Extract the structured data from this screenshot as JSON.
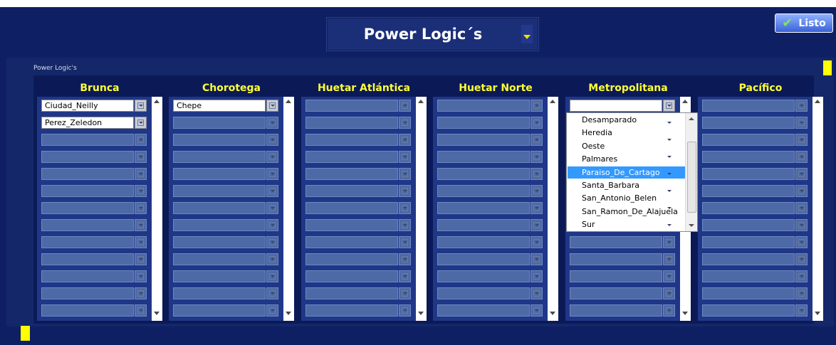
{
  "header": {
    "title": "Power Logic´s",
    "done_label": "Listo"
  },
  "panel": {
    "label": "Power Logic's"
  },
  "columns": [
    {
      "name": "Brunca",
      "rows": [
        "Ciudad_Neilly",
        "Perez_Zeledon",
        "",
        "",
        "",
        "",
        "",
        "",
        "",
        "",
        "",
        "",
        ""
      ]
    },
    {
      "name": "Chorotega",
      "rows": [
        "Chepe",
        "",
        "",
        "",
        "",
        "",
        "",
        "",
        "",
        "",
        "",
        "",
        ""
      ]
    },
    {
      "name": "Huetar Atlántica",
      "rows": [
        "",
        "",
        "",
        "",
        "",
        "",
        "",
        "",
        "",
        "",
        "",
        "",
        ""
      ]
    },
    {
      "name": "Huetar Norte",
      "rows": [
        "",
        "",
        "",
        "",
        "",
        "",
        "",
        "",
        "",
        "",
        "",
        "",
        ""
      ]
    },
    {
      "name": "Metropolitana",
      "rows": [
        "",
        "",
        "",
        "",
        "",
        "",
        "",
        "",
        "",
        "",
        "",
        "",
        ""
      ]
    },
    {
      "name": "Pacífico",
      "rows": [
        "",
        "",
        "",
        "",
        "",
        "",
        "",
        "",
        "",
        "",
        "",
        "",
        ""
      ]
    }
  ],
  "dropdown": {
    "options": [
      "Desamparado",
      "Heredia",
      "Oeste",
      "Palmares",
      "Paraiso_De_Cartago",
      "Santa_Barbara",
      "San_Antonio_Belen",
      "San_Ramon_De_Alajuela",
      "Sur"
    ],
    "highlighted": "Paraiso_De_Cartago"
  },
  "icons": {
    "done": "check-icon",
    "title_menu": "chevron-down-icon",
    "cell_menu": "dropdown-arrow-icon"
  },
  "colors": {
    "background": "#0f1f63",
    "header_text": "#ffff33",
    "highlight": "#3399ff",
    "marker": "#ffff00"
  }
}
